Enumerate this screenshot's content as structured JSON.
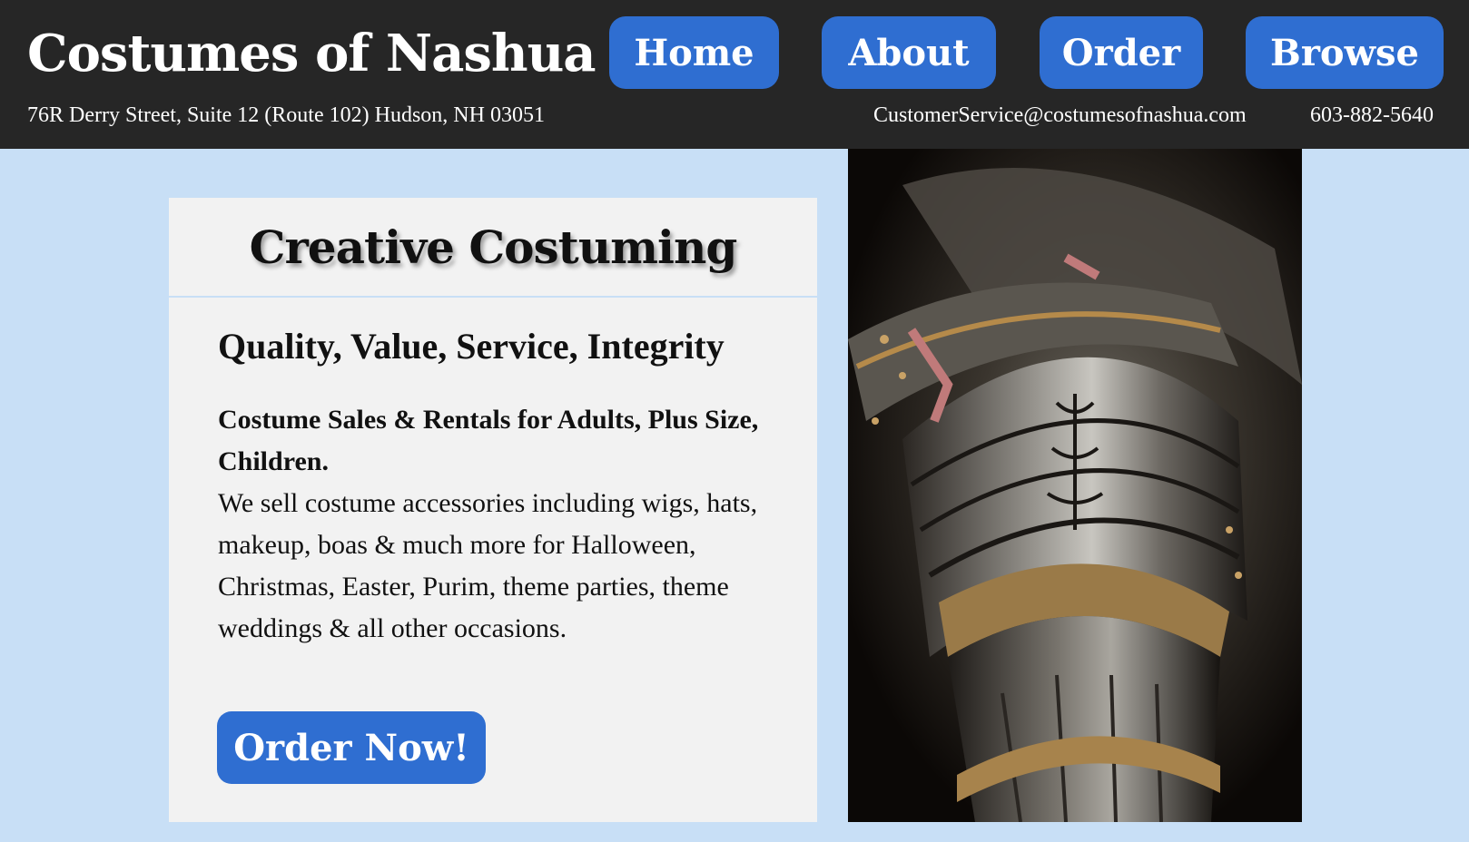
{
  "header": {
    "site_title": "Costumes of Nashua",
    "nav": [
      {
        "label": "Home"
      },
      {
        "label": "About"
      },
      {
        "label": "Order"
      },
      {
        "label": "Browse"
      }
    ],
    "address": "76R Derry Street, Suite 12 (Route 102)  Hudson, NH 03051",
    "email": "CustomerService@costumesofnashua.com",
    "phone": "603-882-5640"
  },
  "card": {
    "heading": "Creative Costuming",
    "tagline": "Quality, Value, Service, Integrity",
    "sales_line": "Costume Sales & Rentals for Adults, Plus Size, Children.",
    "description": "We sell costume accessories including wigs, hats,  makeup, boas & much more for Halloween,  Christmas, Easter, Purim, theme parties,  theme weddings & all other occasions.",
    "order_button": "Order Now!"
  },
  "image": {
    "subject": "knight-armor-photo"
  },
  "colors": {
    "header_bg": "#262626",
    "page_bg": "#c8dff6",
    "card_bg": "#f2f2f2",
    "button_blue": "#2f6ed1"
  }
}
